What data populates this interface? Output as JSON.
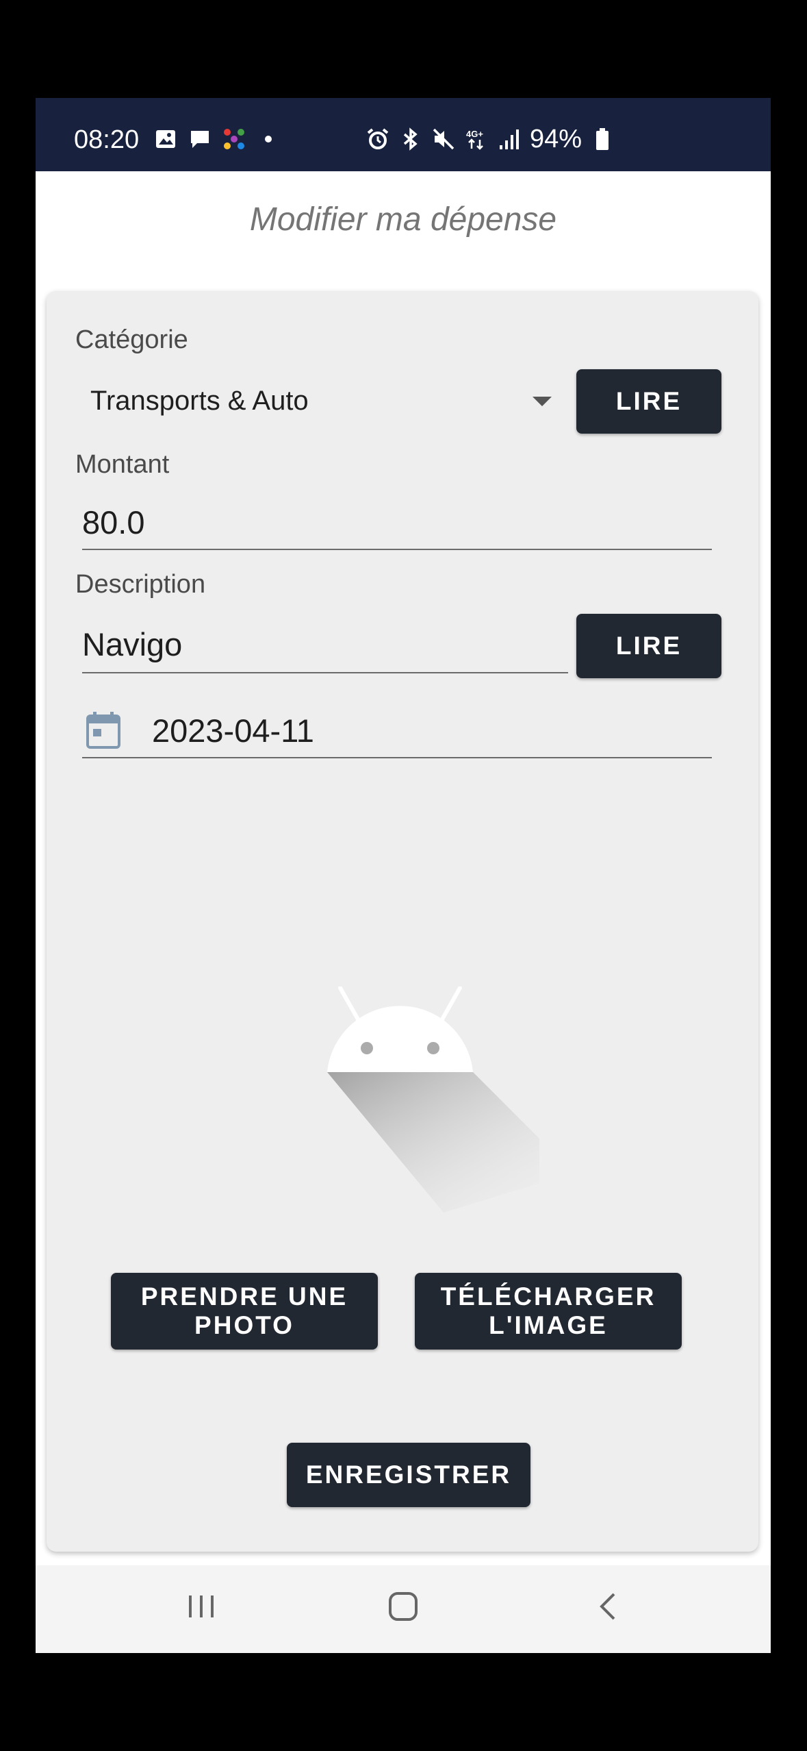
{
  "status_bar": {
    "time": "08:20",
    "battery": "94%",
    "left_icons": [
      "gallery-icon",
      "message-icon",
      "app-icon",
      "dot-icon"
    ],
    "right_icons": [
      "alarm-icon",
      "bluetooth-icon",
      "mute-icon",
      "4g-icon",
      "signal-icon",
      "battery-icon"
    ]
  },
  "header": {
    "title": "Modifier ma dépense"
  },
  "form": {
    "category_label": "Catégorie",
    "category_value": "Transports & Auto",
    "read_button": "LIRE",
    "amount_label": "Montant",
    "amount_value": "80.0",
    "description_label": "Description",
    "description_value": "Navigo",
    "read_button_2": "LIRE",
    "date_value": "2023-04-11"
  },
  "actions": {
    "take_photo": "PRENDRE UNE PHOTO",
    "upload_image": "TÉLÉCHARGER L'IMAGE",
    "save": "ENREGISTRER"
  },
  "colors": {
    "status_bar": "#18223e",
    "button": "#222831",
    "card": "#eeeeee",
    "calendar_icon": "#7f98b0"
  },
  "navigation": [
    "recent-apps-icon",
    "home-icon",
    "back-icon"
  ]
}
